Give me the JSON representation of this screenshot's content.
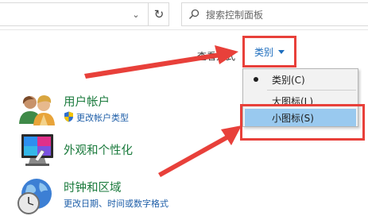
{
  "address_bar": {
    "search_placeholder": "搜索控制面板"
  },
  "view_by": {
    "label": "查看方式",
    "current": "类别"
  },
  "view_menu": {
    "items": [
      {
        "label": "类别(C)",
        "selected": true
      },
      {
        "label": "大图标(L)",
        "selected": false
      },
      {
        "label": "小图标(S)",
        "selected": false,
        "highlighted": true
      }
    ]
  },
  "categories": [
    {
      "title": "用户帐户",
      "links": [
        "更改帐户类型"
      ],
      "icon": "users-icon"
    },
    {
      "title": "外观和个性化",
      "links": [],
      "icon": "appearance-icon"
    },
    {
      "title": "时钟和区域",
      "links": [
        "更改日期、时间或数字格式"
      ],
      "icon": "clock-globe-icon"
    }
  ],
  "colors": {
    "annotation_red": "#e8403a",
    "category_green": "#1a7a3c",
    "link_blue": "#1e5ea8",
    "menu_highlight": "#99c9ef"
  }
}
